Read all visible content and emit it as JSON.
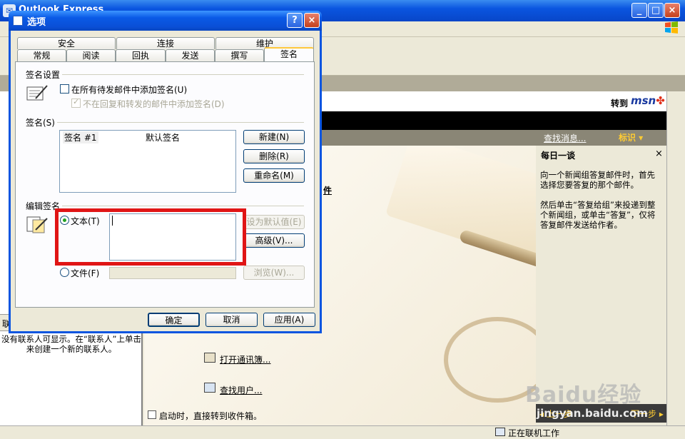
{
  "window": {
    "title": "Outlook Express",
    "minimize": "_",
    "maximize": "□",
    "close": "×"
  },
  "msn": {
    "goto": "转到",
    "logo_main": "msn",
    "logo_accent": ""
  },
  "nav": {
    "find_message": "查找消息...",
    "mark": "标识 ▾"
  },
  "main": {
    "link_fragment": "件",
    "address_book": "打开通讯簿...",
    "find_people": "查找用户...",
    "startup": "启动时，直接转到收件箱。"
  },
  "contacts": {
    "header": "联",
    "empty_message": "没有联系人可显示。在“联系人”上单击来创建一个新的联系人。"
  },
  "tip": {
    "title": "每日一谈",
    "close": "×",
    "p1": "向一个新闻组答复邮件时，首先选择您要答复的那个邮件。",
    "p2": "然后单击“答复给组”来投递到整个新闻组，或单击“答复”，仅将答复邮件发送给作者。",
    "prev": "◂ 上一步",
    "next": "下一步 ▸"
  },
  "status": {
    "text": "正在联机工作"
  },
  "watermark": {
    "logo": "Baidu经验",
    "url": "jingyan.baidu.com"
  },
  "dialog": {
    "title": "选项",
    "help": "?",
    "close": "×",
    "tabs_row1": [
      "安全",
      "连接",
      "维护"
    ],
    "tabs_row2": [
      "常规",
      "阅读",
      "回执",
      "发送",
      "撰写",
      "签名"
    ],
    "active_tab": "签名",
    "sig_settings": {
      "label": "签名设置",
      "add_all": "在所有待发邮件中添加签名(U)",
      "no_reply": "不在回复和转发的邮件中添加签名(D)"
    },
    "signatures": {
      "label": "签名(S)",
      "rows": [
        {
          "name": "签名 #1",
          "note": "默认签名"
        }
      ],
      "new": "新建(N)",
      "delete": "删除(R)",
      "rename": "重命名(M)"
    },
    "edit": {
      "label": "编辑签名",
      "text_option": "文本(T)",
      "file_option": "文件(F)",
      "set_default": "设为默认值(E)",
      "advanced": "高级(V)...",
      "browse": "浏览(W)..."
    },
    "ok": "确定",
    "cancel": "取消",
    "apply": "应用(A)"
  }
}
